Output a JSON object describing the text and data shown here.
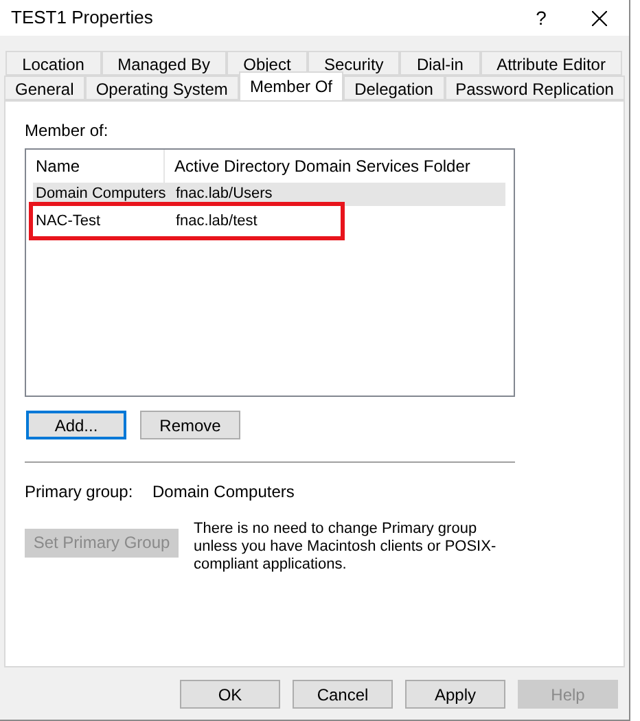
{
  "window": {
    "title": "TEST1 Properties",
    "help_button": "?"
  },
  "tab_rows": [
    [
      {
        "label": "Location",
        "selected": false
      },
      {
        "label": "Managed By",
        "selected": false
      },
      {
        "label": "Object",
        "selected": false
      },
      {
        "label": "Security",
        "selected": false
      },
      {
        "label": "Dial-in",
        "selected": false
      },
      {
        "label": "Attribute Editor",
        "selected": false
      }
    ],
    [
      {
        "label": "General",
        "selected": false
      },
      {
        "label": "Operating System",
        "selected": false
      },
      {
        "label": "Member Of",
        "selected": true
      },
      {
        "label": "Delegation",
        "selected": false
      },
      {
        "label": "Password Replication",
        "selected": false
      }
    ]
  ],
  "member_of": {
    "label": "Member of:",
    "columns": [
      "Name",
      "Active Directory Domain Services Folder"
    ],
    "rows": [
      {
        "name": "Domain Computers",
        "folder": "fnac.lab/Users",
        "selected": true,
        "highlighted": false
      },
      {
        "name": "NAC-Test",
        "folder": "fnac.lab/test",
        "selected": false,
        "highlighted": true
      }
    ]
  },
  "list_buttons": [
    {
      "label": "Add...",
      "focused": true
    },
    {
      "label": "Remove",
      "focused": false
    }
  ],
  "primary_group": {
    "label": "Primary group:",
    "value": "Domain Computers"
  },
  "set_primary_group": {
    "label": "Set Primary Group",
    "disabled": true
  },
  "note": "There is no need to change Primary group unless you have Macintosh clients or POSIX-compliant applications.",
  "footer_buttons": [
    {
      "label": "OK",
      "disabled": false
    },
    {
      "label": "Cancel",
      "disabled": false
    },
    {
      "label": "Apply",
      "disabled": false
    },
    {
      "label": "Help",
      "disabled": true
    }
  ]
}
